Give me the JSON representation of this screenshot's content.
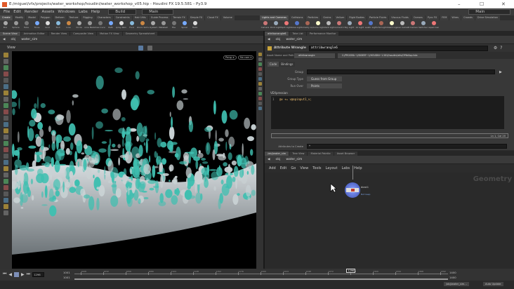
{
  "window": {
    "title": "E:/miguel/vfx/projects/water_workshop/houdini/water_workshop_v05.hip - Houdini FX 19.5.581 - Py3.9",
    "min": "–",
    "max": "☐",
    "close": "✕"
  },
  "menu": [
    "File",
    "Edit",
    "Render",
    "Assets",
    "Windows",
    "Labs",
    "Help"
  ],
  "desktop_left": "Build",
  "desktop_main": "Main",
  "desktop_right": "Main",
  "shelf_left": {
    "tabs": [
      "Create",
      "Modify",
      "Model",
      "Polygon",
      "Deform",
      "Texture",
      "Rigging",
      "Characters",
      "Constraints",
      "Hair Utils",
      "Guide Process",
      "Terrain FX",
      "Simple FX",
      "Cloud FX",
      "Volume"
    ],
    "tools": [
      "Box",
      "Sphere",
      "Tube",
      "Torus",
      "Grid",
      "Null",
      "Line",
      "Circle",
      "Curve Bezier",
      "Draw Curve",
      "Path",
      "Spray Paint",
      "Font",
      "Platonic Solids",
      "L-System",
      "Metaball",
      "File",
      "Spiral",
      "Helix"
    ]
  },
  "shelf_right": {
    "tabs": [
      "Lights and Cameras",
      "Collisions",
      "Particles",
      "Grains",
      "Vellum",
      "Rigid Bodies",
      "Particle Fluids",
      "Viscous Fluids",
      "Oceans",
      "Pyro FX",
      "FEM",
      "Wires",
      "Crowds",
      "Drive Simulation"
    ],
    "tools": [
      "Camera",
      "Point Light",
      "Spot Light",
      "Area Light",
      "Geometry Light",
      "Volume Light",
      "Distant Light",
      "Environment Light",
      "Sky Light",
      "GI Light",
      "Caustic Light",
      "Portal Light",
      "Ambient Light",
      "Stereo Camera",
      "VR Camera",
      "Switcher",
      "Gamepad Camera"
    ]
  },
  "left_pane": {
    "tabs": [
      "Scene View",
      "Animation Editor",
      "Render View",
      "Composite View",
      "Motion FX View",
      "Geometry Spreadsheet"
    ],
    "path": [
      "obj",
      "water_sim"
    ],
    "view_label": "View",
    "persp": "Persp ▾",
    "cam": "No cam ▾"
  },
  "param_pane": {
    "tabs": [
      "attribwrangle6",
      "Take List",
      "Performance Monitor"
    ],
    "path": [
      "obj",
      "water_sim"
    ],
    "node_type": "Attribute Wrangle",
    "node_name": "attribwrangle6",
    "asset_label": "Asset Name and Path",
    "asset_name": "attribwrangle",
    "asset_path": "C:/PROGRA~1/SIDEEF~1/HOUDIN~1.581/houdini/otls/OPlibSop.hda",
    "code_tabs": [
      "Code",
      "Bindings"
    ],
    "group_label": "Group",
    "group_value": "",
    "group_type_label": "Group Type",
    "group_type": "Guess from Group",
    "run_over_label": "Run Over",
    "run_over": "Points",
    "vex_label": "VEXpression",
    "line_no": "1",
    "code": "@v += v@opinput1_v;",
    "cursor": "Ln 1, Col 20",
    "attr_create_label": "Attributes to Create",
    "attr_create": "*"
  },
  "network_pane": {
    "tabs": [
      "/obj/water_sim",
      "Tree View",
      "Material Palette",
      "Asset Browser"
    ],
    "path": [
      "obj",
      "water_sim"
    ],
    "menu": [
      "Add",
      "Edit",
      "Go",
      "View",
      "Tools",
      "Layout",
      "Labs",
      "Help"
    ],
    "context": "Geometry",
    "node": {
      "name": "blast1",
      "sub": "Not  keep"
    }
  },
  "playbar": {
    "frame": "1296",
    "start": "1001",
    "start2": "1001",
    "end": "1400",
    "end2": "1400",
    "ticks": [
      "1008",
      "1032",
      "1056",
      "1080",
      "1104",
      "1128",
      "1152",
      "1176",
      "1200",
      "1224",
      "1248",
      "1272",
      "1296",
      "1320",
      "1344",
      "1368",
      "1392"
    ],
    "range": [
      1001,
      1400
    ]
  },
  "status": {
    "path": "/obj/water_sim...",
    "update": "Auto Update"
  },
  "colors": {
    "water": "#3fbfb0",
    "accent": "#ffcc66"
  }
}
